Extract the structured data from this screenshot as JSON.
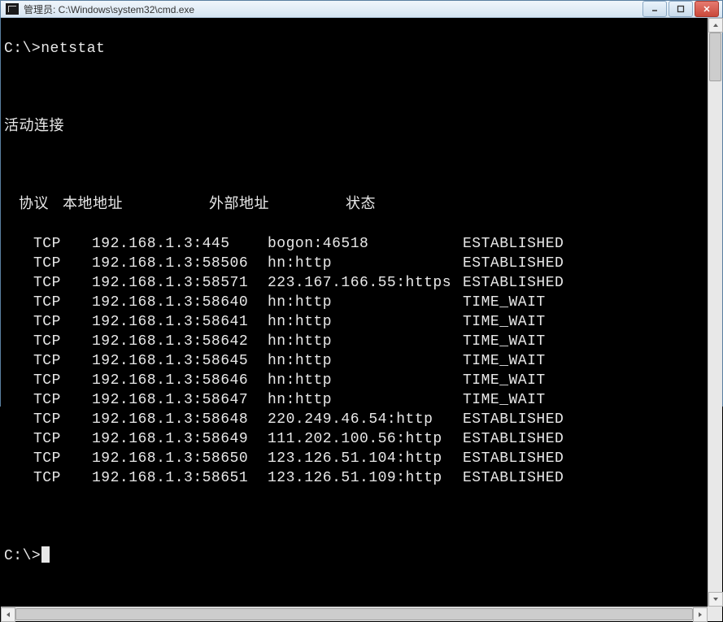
{
  "window": {
    "title": "管理员: C:\\Windows\\system32\\cmd.exe"
  },
  "terminal": {
    "prompt1": "C:\\>",
    "command": "netstat",
    "section_title": "活动连接",
    "headers": {
      "proto": "协议",
      "local": "本地地址",
      "foreign": "外部地址",
      "state": "状态"
    },
    "rows": [
      {
        "proto": "TCP",
        "local": "192.168.1.3:445",
        "foreign": "bogon:46518",
        "state": "ESTABLISHED"
      },
      {
        "proto": "TCP",
        "local": "192.168.1.3:58506",
        "foreign": "hn:http",
        "state": "ESTABLISHED"
      },
      {
        "proto": "TCP",
        "local": "192.168.1.3:58571",
        "foreign": "223.167.166.55:https",
        "state": "ESTABLISHED"
      },
      {
        "proto": "TCP",
        "local": "192.168.1.3:58640",
        "foreign": "hn:http",
        "state": "TIME_WAIT"
      },
      {
        "proto": "TCP",
        "local": "192.168.1.3:58641",
        "foreign": "hn:http",
        "state": "TIME_WAIT"
      },
      {
        "proto": "TCP",
        "local": "192.168.1.3:58642",
        "foreign": "hn:http",
        "state": "TIME_WAIT"
      },
      {
        "proto": "TCP",
        "local": "192.168.1.3:58645",
        "foreign": "hn:http",
        "state": "TIME_WAIT"
      },
      {
        "proto": "TCP",
        "local": "192.168.1.3:58646",
        "foreign": "hn:http",
        "state": "TIME_WAIT"
      },
      {
        "proto": "TCP",
        "local": "192.168.1.3:58647",
        "foreign": "hn:http",
        "state": "TIME_WAIT"
      },
      {
        "proto": "TCP",
        "local": "192.168.1.3:58648",
        "foreign": "220.249.46.54:http",
        "state": "ESTABLISHED"
      },
      {
        "proto": "TCP",
        "local": "192.168.1.3:58649",
        "foreign": "111.202.100.56:http",
        "state": "ESTABLISHED"
      },
      {
        "proto": "TCP",
        "local": "192.168.1.3:58650",
        "foreign": "123.126.51.104:http",
        "state": "ESTABLISHED"
      },
      {
        "proto": "TCP",
        "local": "192.168.1.3:58651",
        "foreign": "123.126.51.109:http",
        "state": "ESTABLISHED"
      }
    ],
    "prompt2": "C:\\>"
  }
}
